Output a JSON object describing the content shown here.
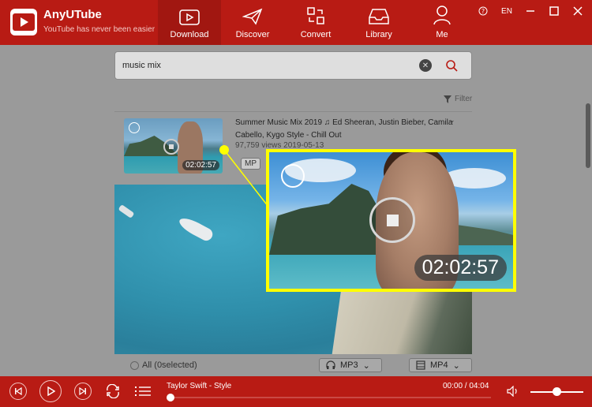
{
  "app": {
    "name": "AnyUTube",
    "tagline": "YouTube has never been easier"
  },
  "nav": [
    {
      "label": "Download",
      "icon": "play-screen-icon",
      "active": true
    },
    {
      "label": "Discover",
      "icon": "paper-plane-icon",
      "active": false
    },
    {
      "label": "Convert",
      "icon": "convert-icon",
      "active": false
    },
    {
      "label": "Library",
      "icon": "tray-icon",
      "active": false
    },
    {
      "label": "Me",
      "icon": "user-icon",
      "active": false
    }
  ],
  "window": {
    "help": "?",
    "lang": "EN"
  },
  "search": {
    "value": "music mix"
  },
  "filter_label": "Filter",
  "result": {
    "title": "Summer Music Mix 2019 ♫ Ed Sheeran, Justin Bieber, Camila Cabello, Kygo Style - Chill Out",
    "views": "97,759 views 2019-05-13",
    "duration": "02:02:57",
    "chip": "MP"
  },
  "bottom": {
    "all_label": "All (0selected)",
    "mp3_label": "MP3",
    "mp4_label": "MP4"
  },
  "player": {
    "track": "Taylor Swift - Style",
    "time": "00:00 / 04:04",
    "progress": 0.0
  },
  "zoom": {
    "duration": "02:02:57"
  },
  "colors": {
    "brand_red": "#b81b14",
    "callout_yellow": "#ffff00"
  }
}
